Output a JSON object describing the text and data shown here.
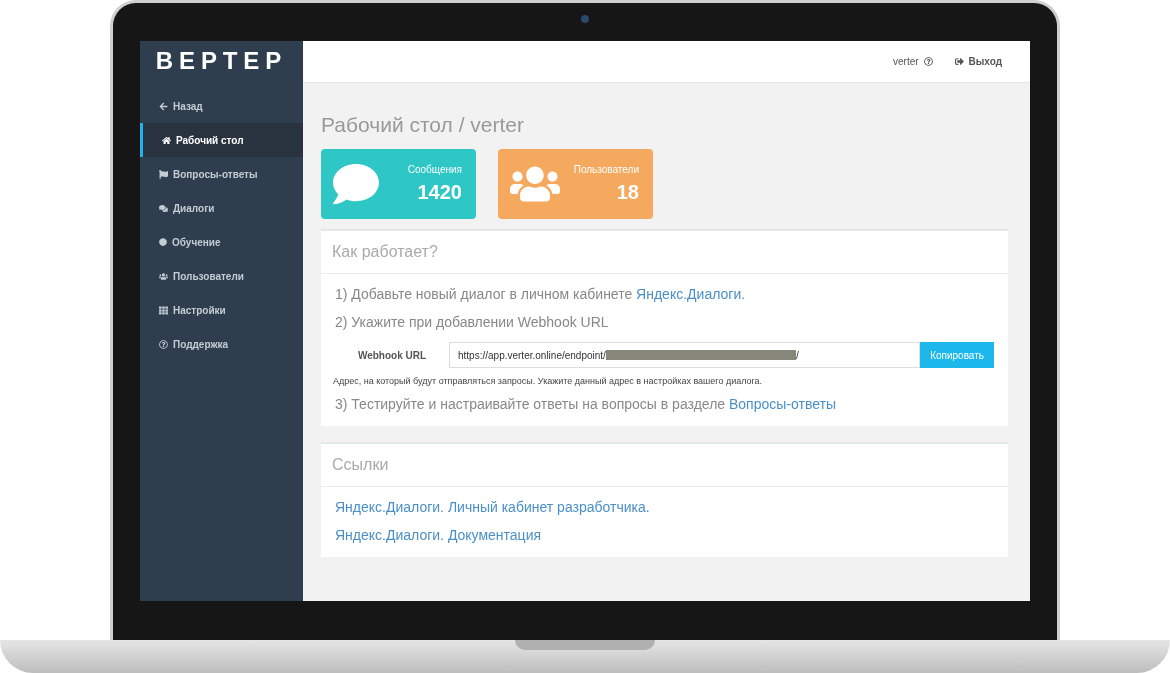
{
  "sidebar": {
    "logo": "ВЕРТЕР",
    "items": [
      {
        "label": "Назад",
        "selected": false
      },
      {
        "label": "Рабочий стол",
        "selected": true
      },
      {
        "label": "Вопросы-ответы",
        "selected": false
      },
      {
        "label": "Диалоги",
        "selected": false
      },
      {
        "label": "Обучение",
        "selected": false
      },
      {
        "label": "Пользователи",
        "selected": false
      },
      {
        "label": "Настройки",
        "selected": false
      },
      {
        "label": "Поддержка",
        "selected": false
      }
    ]
  },
  "topbar": {
    "user": "verter",
    "logout": "Выход"
  },
  "page_title": "Рабочий стол / verter",
  "stats": [
    {
      "label": "Сообщения",
      "value": "1420",
      "color": "#2fc6c6"
    },
    {
      "label": "Пользователи",
      "value": "18",
      "color": "#f5a95f"
    }
  ],
  "how_it_works": {
    "title": "Как работает?",
    "step1": "1) Добавьте новый диалог в личном кабинете ",
    "step1_link": "Яндекс.Диалоги.",
    "step2": "2) Укажите при добавлении Webhook URL",
    "webhook_label": "Webhook URL",
    "webhook_value": "https://app.verter.online/endpoint/",
    "webhook_suffix": "/",
    "copy_button": "Копировать",
    "hint": "Адрес, на который будут отправляться запросы. Укажите данный адрес в настройках вашего диалога.",
    "step3": "3) Тестируйте и настраивайте ответы на вопросы в разделе ",
    "step3_link": "Вопросы-ответы"
  },
  "links": {
    "title": "Ссылки",
    "items": [
      "Яндекс.Диалоги. Личный кабинет разработчика.",
      "Яндекс.Диалоги. Документация"
    ]
  }
}
